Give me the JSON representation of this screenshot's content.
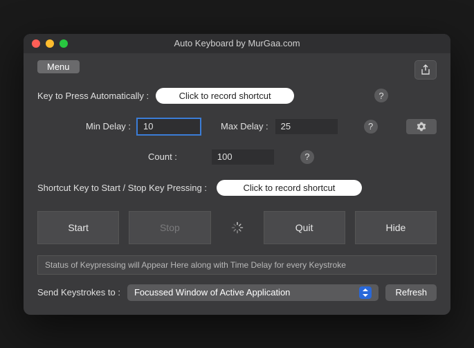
{
  "window": {
    "title": "Auto Keyboard by MurGaa.com"
  },
  "toolbar": {
    "menu_label": "Menu"
  },
  "keyToPress": {
    "label": "Key to Press Automatically :",
    "button": "Click to record shortcut",
    "help": "?"
  },
  "delays": {
    "min_label": "Min Delay :",
    "min_value": "10",
    "max_label": "Max Delay :",
    "max_value": "25",
    "help": "?"
  },
  "count": {
    "label": "Count :",
    "value": "100",
    "help": "?"
  },
  "shortcut": {
    "label": "Shortcut Key to Start / Stop Key Pressing :",
    "button": "Click to record shortcut"
  },
  "actions": {
    "start": "Start",
    "stop": "Stop",
    "quit": "Quit",
    "hide": "Hide"
  },
  "status": {
    "text": "Status of Keypressing will Appear Here along with Time Delay for every Keystroke"
  },
  "sendTo": {
    "label": "Send Keystrokes to :",
    "selected": "Focussed Window of Active Application",
    "refresh": "Refresh"
  }
}
